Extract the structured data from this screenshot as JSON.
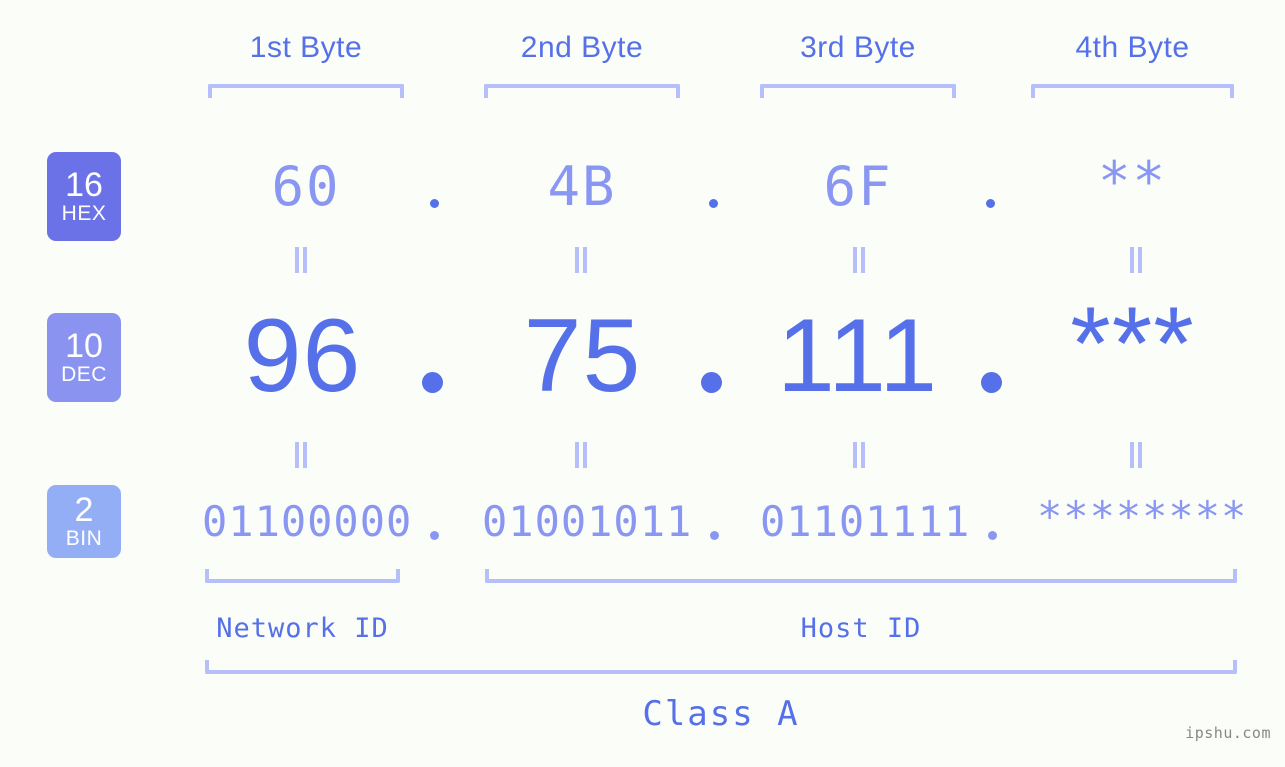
{
  "meta": {
    "background_color": "#fbfdf8",
    "accent_strong": "#5570e8",
    "accent_mid": "#8a97f2",
    "accent_light": "#b6bffa",
    "watermark": "ipshu.com"
  },
  "byte_headers": [
    {
      "label": "1st Byte"
    },
    {
      "label": "2nd Byte"
    },
    {
      "label": "3rd Byte"
    },
    {
      "label": "4th Byte"
    }
  ],
  "bases": [
    {
      "number": "16",
      "name": "HEX",
      "color": "#6b72e8"
    },
    {
      "number": "10",
      "name": "DEC",
      "color": "#8a93f0"
    },
    {
      "number": "2",
      "name": "BIN",
      "color": "#94aef5"
    }
  ],
  "rows": {
    "hex": {
      "values": [
        "60",
        "4B",
        "6F",
        "**"
      ],
      "separator": "."
    },
    "dec": {
      "values": [
        "96",
        "75",
        "111",
        "***"
      ],
      "separator": "."
    },
    "bin": {
      "values": [
        "01100000",
        "01001011",
        "01101111",
        "********"
      ],
      "separator": "."
    }
  },
  "equals_marks": {
    "symbol": "||",
    "count_per_row": 4
  },
  "sections": [
    {
      "label": "Network ID"
    },
    {
      "label": "Host ID"
    }
  ],
  "class": {
    "label": "Class A"
  }
}
